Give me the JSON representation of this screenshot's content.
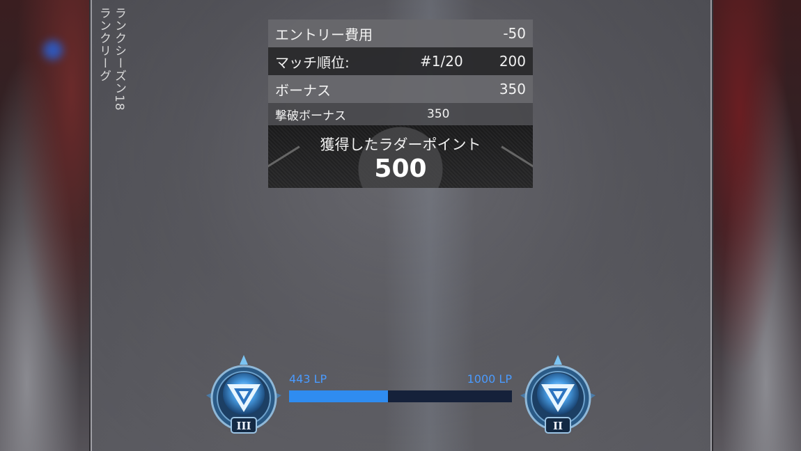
{
  "season": {
    "line1": "ランクシーズン18",
    "line2": "ランクリーグ"
  },
  "breakdown": {
    "entry_cost": {
      "label": "エントリー費用",
      "value": "-50"
    },
    "match_placement": {
      "label": "マッチ順位:",
      "placement": "#1/20",
      "value": "200"
    },
    "bonus": {
      "label": "ボーナス",
      "value": "350"
    },
    "kill_bonus": {
      "label": "撃破ボーナス",
      "value": "350"
    }
  },
  "total": {
    "label": "獲得したラダーポイント",
    "value": "500"
  },
  "progress": {
    "current_label": "443 LP",
    "target_label": "1000 LP",
    "current": 443,
    "target": 1000,
    "color": "#2f8cf0"
  },
  "ranks": {
    "current": {
      "tier": "III",
      "icon": "diamond-rank-badge-icon"
    },
    "next": {
      "tier": "II",
      "icon": "diamond-rank-badge-icon"
    }
  }
}
